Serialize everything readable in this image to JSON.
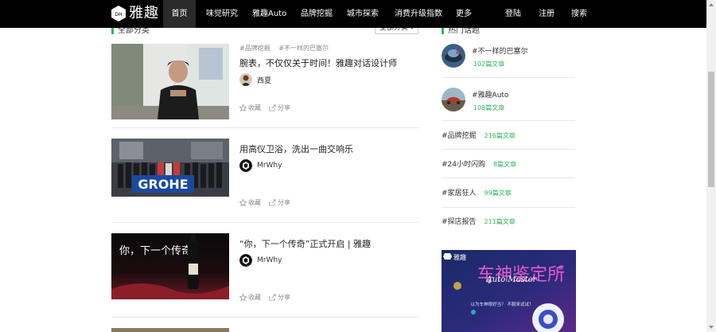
{
  "brand": {
    "name": "雅趣"
  },
  "nav": {
    "items": [
      {
        "label": "首页",
        "active": true
      },
      {
        "label": "味觉研究"
      },
      {
        "label": "雅趣Auto"
      },
      {
        "label": "品牌挖掘"
      },
      {
        "label": "城市探索"
      },
      {
        "label": "消费升级指数"
      },
      {
        "label": "更多"
      }
    ],
    "login": "登陆",
    "register": "注册",
    "search": "搜索"
  },
  "main": {
    "section_title": "全部分类",
    "filter_label": "全部分类 ▾",
    "articles": [
      {
        "tags": [
          "#品牌挖掘",
          "#不一样的巴塞尔"
        ],
        "title": "腕表，不仅仅关于时间！雅趣对话设计师",
        "author": "西夏",
        "collect": "收藏",
        "share": "分享"
      },
      {
        "tags": [],
        "title": "用高仪卫浴，洗出一曲交响乐",
        "author": "MrWhy",
        "collect": "收藏",
        "share": "分享",
        "image_text": "GROHE"
      },
      {
        "tags": [],
        "title": "“你，下一个传奇”正式开启 | 雅趣",
        "author": "MrWhy",
        "collect": "收藏",
        "share": "分享",
        "image_text": "你，下一个传奇"
      }
    ]
  },
  "sidebar": {
    "title": "热门话题",
    "topics": [
      {
        "name": "#不一样的巴塞尔",
        "count": "102篇文章"
      },
      {
        "name": "#雅趣Auto",
        "count": "108篇文章"
      }
    ],
    "plain_topics": [
      {
        "name": "#品牌挖掘",
        "count": "216篇文章"
      },
      {
        "name": "#24小时闪购",
        "count": "8篇文章"
      },
      {
        "name": "#家居狂人",
        "count": "99篇文章"
      },
      {
        "name": "#探店报告",
        "count": "211篇文章"
      }
    ],
    "ad": {
      "brand": "雅趣",
      "headline": "车神鉴定所",
      "sub_en": "Auto Master",
      "caption": "以为车神很好当？ 不服来试试！"
    }
  },
  "colors": {
    "accent": "#2eb85c",
    "nav_bg": "#000000"
  }
}
